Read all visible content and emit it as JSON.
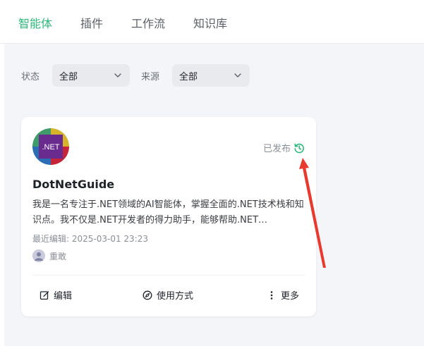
{
  "tabs": [
    {
      "label": "智能体",
      "active": true
    },
    {
      "label": "插件",
      "active": false
    },
    {
      "label": "工作流",
      "active": false
    },
    {
      "label": "知识库",
      "active": false
    }
  ],
  "filters": {
    "status_label": "状态",
    "status_value": "全部",
    "source_label": "来源",
    "source_value": "全部"
  },
  "card": {
    "avatar_text": ".NET",
    "status_text": "已发布",
    "name": "DotNetGuide",
    "description": "我是一名专注于.NET领域的AI智能体，掌握全面的.NET技术栈和知识点。我不仅是.NET开发者的得力助手，能够帮助.NET…",
    "last_edited": "最近编辑: 2025-03-01 23:23",
    "owner": "重敢",
    "actions": {
      "edit": "编辑",
      "usage": "使用方式",
      "more": "更多"
    }
  },
  "colors": {
    "accent": "#2fb67b",
    "annotation": "#e8392f",
    "avatar_purple": "#6a2b8f"
  }
}
